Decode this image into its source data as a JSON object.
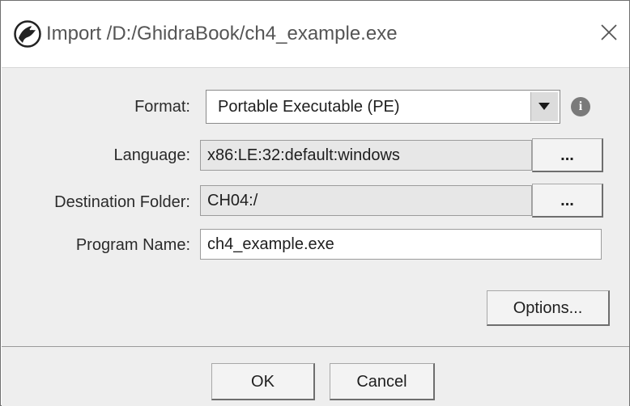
{
  "window": {
    "title": "Import /D:/GhidraBook/ch4_example.exe",
    "close_glyph": "✕"
  },
  "form": {
    "format": {
      "label": "Format:",
      "value": "Portable Executable (PE)",
      "info_glyph": "i"
    },
    "language": {
      "label": "Language:",
      "value": "x86:LE:32:default:windows",
      "browse_label": "..."
    },
    "destination": {
      "label": "Destination Folder:",
      "value": "CH04:/",
      "browse_label": "..."
    },
    "program_name": {
      "label": "Program Name:",
      "value": "ch4_example.exe"
    },
    "options_label": "Options..."
  },
  "footer": {
    "ok_label": "OK",
    "cancel_label": "Cancel"
  },
  "icons": {
    "app": "ghidra-dragon-icon",
    "close": "close-icon",
    "dropdown": "chevron-down-icon",
    "info": "info-icon"
  },
  "colors": {
    "panel_bg": "#eeeeee",
    "readonly_field_bg": "#e7e7e7",
    "editable_field_bg": "#ffffff",
    "info_icon_bg": "#7a7a7a"
  }
}
